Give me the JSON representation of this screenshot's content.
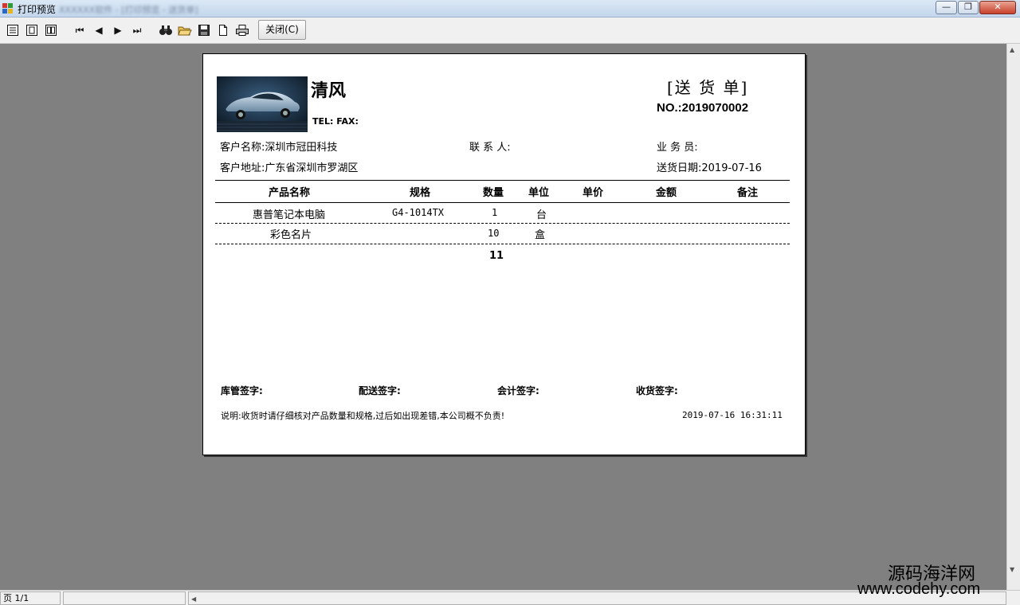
{
  "window": {
    "title": "打印预览",
    "title_blurred": "XXXXXX软件 - [打印预览 - 送货单]",
    "buttons": {
      "minimize": "—",
      "restore": "❐",
      "close": "✕"
    }
  },
  "toolbar": {
    "icons": [
      "page-width-icon",
      "one-page-icon",
      "two-page-icon",
      "first-page-icon",
      "prev-page-icon",
      "next-page-icon",
      "last-page-icon",
      "find-icon",
      "open-icon",
      "save-icon",
      "new-page-icon",
      "print-icon"
    ],
    "glyphs": {
      "first": "⏮",
      "prev": "◀",
      "next": "▶",
      "last": "⏭"
    },
    "close_label": "关闭(C)"
  },
  "doc": {
    "company": "清风",
    "telfax": "TEL: FAX:",
    "title": "[送 货 单]",
    "number": "NO.:2019070002",
    "customer_name": "客户名称:深圳市冠田科技",
    "contact": "联 系 人:",
    "salesman": "业 务 员:",
    "address": "客户地址:广东省深圳市罗湖区",
    "delivery_date": "送货日期:2019-07-16",
    "table": {
      "headers": [
        "产品名称",
        "规格",
        "数量",
        "单位",
        "单价",
        "金额",
        "备注"
      ],
      "rows": [
        {
          "name": "惠普笔记本电脑",
          "spec": "G4-1014TX",
          "qty": "1",
          "unit": "台",
          "price": "",
          "amount": "",
          "remark": ""
        },
        {
          "name": "彩色名片",
          "spec": "",
          "qty": "10",
          "unit": "盒",
          "price": "",
          "amount": "",
          "remark": ""
        }
      ],
      "total_qty": "11"
    },
    "signatures": [
      "库管签字:",
      "配送签字:",
      "会计签字:",
      "收货签字:"
    ],
    "note": "说明:收货时请仔细核对产品数量和规格,过后如出现差错,本公司概不负责!",
    "print_time": "2019-07-16 16:31:11"
  },
  "status": {
    "page": "页 1/1"
  },
  "watermark": {
    "line1": "源码海洋网",
    "line2": "www.codehy.com"
  }
}
